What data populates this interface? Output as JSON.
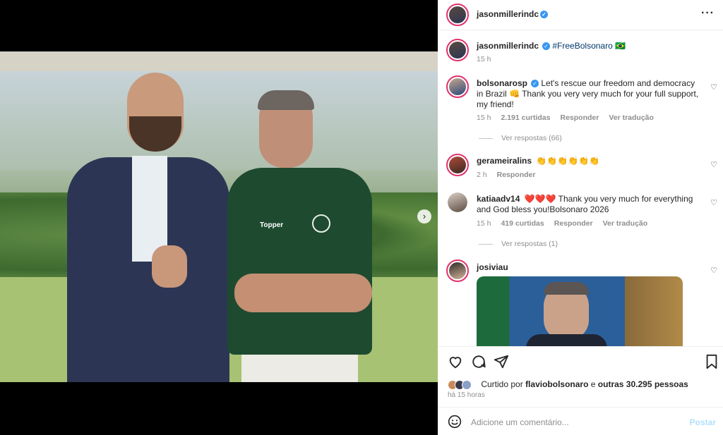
{
  "header": {
    "username": "jasonmillerindc"
  },
  "caption": {
    "username": "jasonmillerindc",
    "hashtag": "#FreeBolsonaro",
    "flag": "🇧🇷",
    "age": "15 h"
  },
  "comments": [
    {
      "username": "bolsonarosp",
      "text": "Let's rescue our freedom and democracy in Brazil 👊 Thank you very very much for your full support, my friend!",
      "age": "15 h",
      "likes": "2.191 curtidas",
      "reply": "Responder",
      "translate": "Ver tradução",
      "view_replies": "Ver respostas (66)"
    },
    {
      "username": "gerameiralins",
      "text": "👏👏👏👏👏👏",
      "age": "2 h",
      "reply": "Responder"
    },
    {
      "username": "katiaadv14",
      "text": "❤️❤️❤️ Thank you very much for everything and God bless you!Bolsonaro 2026",
      "age": "15 h",
      "likes": "419 curtidas",
      "reply": "Responder",
      "translate": "Ver tradução",
      "view_replies": "Ver respostas (1)"
    },
    {
      "username": "josiviau"
    }
  ],
  "media": {
    "jersey_brand": "Topper"
  },
  "likes": {
    "prefix": "Curtido por",
    "user": "flaviobolsonaro",
    "joiner": "e",
    "others": "outras 30.295 pessoas"
  },
  "post_time": "há 15 horas",
  "comment_box": {
    "placeholder": "Adicione um comentário...",
    "post": "Postar"
  },
  "icons": {
    "more": "more-icon",
    "heart": "heart-icon",
    "comment": "comment-icon",
    "share": "share-icon",
    "save": "bookmark-icon",
    "emoji": "emoji-icon"
  },
  "colors": {
    "link": "#00376b",
    "verified": "#3897f0",
    "muted": "#8e8e8e",
    "post_disabled": "#b2dffc"
  }
}
